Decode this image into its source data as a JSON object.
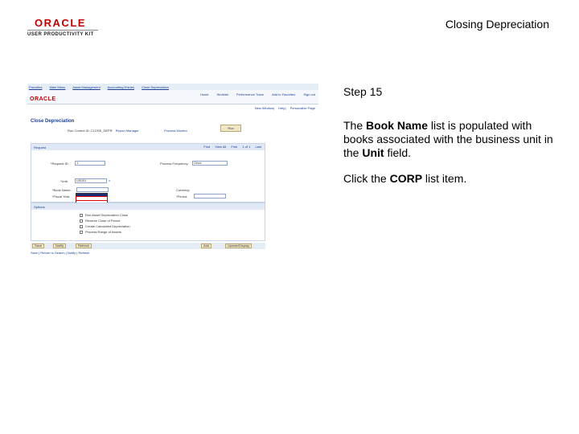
{
  "header": {
    "logo_oracle": "ORACLE",
    "logo_upk": "USER PRODUCTIVITY KIT",
    "title": "Closing Depreciation"
  },
  "screenshot": {
    "top_nav": [
      "Favorites",
      "Main Menu",
      "Asset Management",
      "Accounting Entries",
      "Close Depreciation"
    ],
    "brand": "ORACLE",
    "header_links": [
      "Home",
      "Worklist",
      "Performance Trace",
      "Add to Favorites",
      "Sign out"
    ],
    "sub_links": [
      "New Window",
      "Help",
      "Personalize Page"
    ],
    "page_heading": "Close Depreciation",
    "run_control": "Run Control ID: CLOSE_DEPR",
    "report_manager": "Report Manager",
    "process_monitor": "Process Monitor",
    "run_button": "Run",
    "request_header": "Request",
    "rc_nav": [
      "Find",
      "View All",
      "First",
      "1 of 1",
      "Last"
    ],
    "request_id_label": "*Request ID:",
    "request_id_value": "1",
    "process_frequency_label": "Process Frequency:",
    "process_frequency_value": "Once",
    "unit_label": "*Unit:",
    "unit_value": "US001",
    "book_name_label": "*Book Name:",
    "currency_label": "Currency:",
    "fiscal_year_label": "*Fiscal Year:",
    "period_label": "*Period:",
    "options_header": "Options",
    "options": [
      "Run Asset Depreciation Close",
      "Reverse Close of Period",
      "Create Calculated Depreciation",
      "Process Range of Assets"
    ],
    "bottom_buttons": [
      "Save",
      "Notify",
      "Refresh",
      "Add",
      "Update/Display"
    ],
    "footer_links": "Save | Return to Search | Notify | Refresh"
  },
  "instructions": {
    "step": "Step 15",
    "desc_part1": "The ",
    "desc_bold1": "Book Name",
    "desc_part2": " list is populated with books associated with the business unit in the ",
    "desc_bold2": "Unit",
    "desc_part3": " field.",
    "action_part1": "Click the ",
    "action_bold": "CORP",
    "action_part2": " list item."
  }
}
